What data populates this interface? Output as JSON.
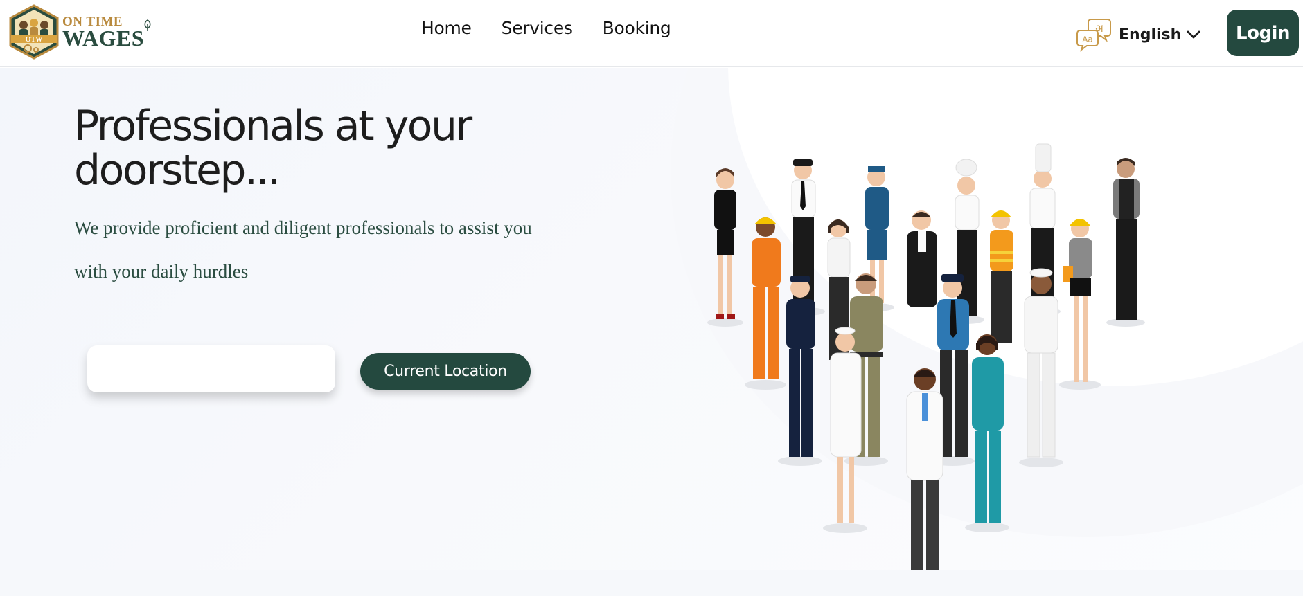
{
  "header": {
    "logo": {
      "line1": "ON TIME",
      "line2": "WAGES",
      "badge_text": "OTW"
    },
    "nav": [
      {
        "label": "Home"
      },
      {
        "label": "Services"
      },
      {
        "label": "Booking"
      }
    ],
    "language": {
      "icon": "translate-icon",
      "icon_glyph_top": "अ",
      "icon_glyph_bottom": "Aa",
      "label": "English"
    },
    "login_label": "Login"
  },
  "hero": {
    "title": "Professionals at your doorstep...",
    "subtitle": "We provide proficient and diligent professionals to assist you with your daily hurdles",
    "location_input": {
      "value": "",
      "placeholder": ""
    },
    "current_location_label": "Current Location"
  },
  "colors": {
    "brand_green": "#24493f",
    "brand_gold": "#b98a3e",
    "text_dark": "#1d1d1d",
    "subtitle_green": "#2b4d41"
  }
}
